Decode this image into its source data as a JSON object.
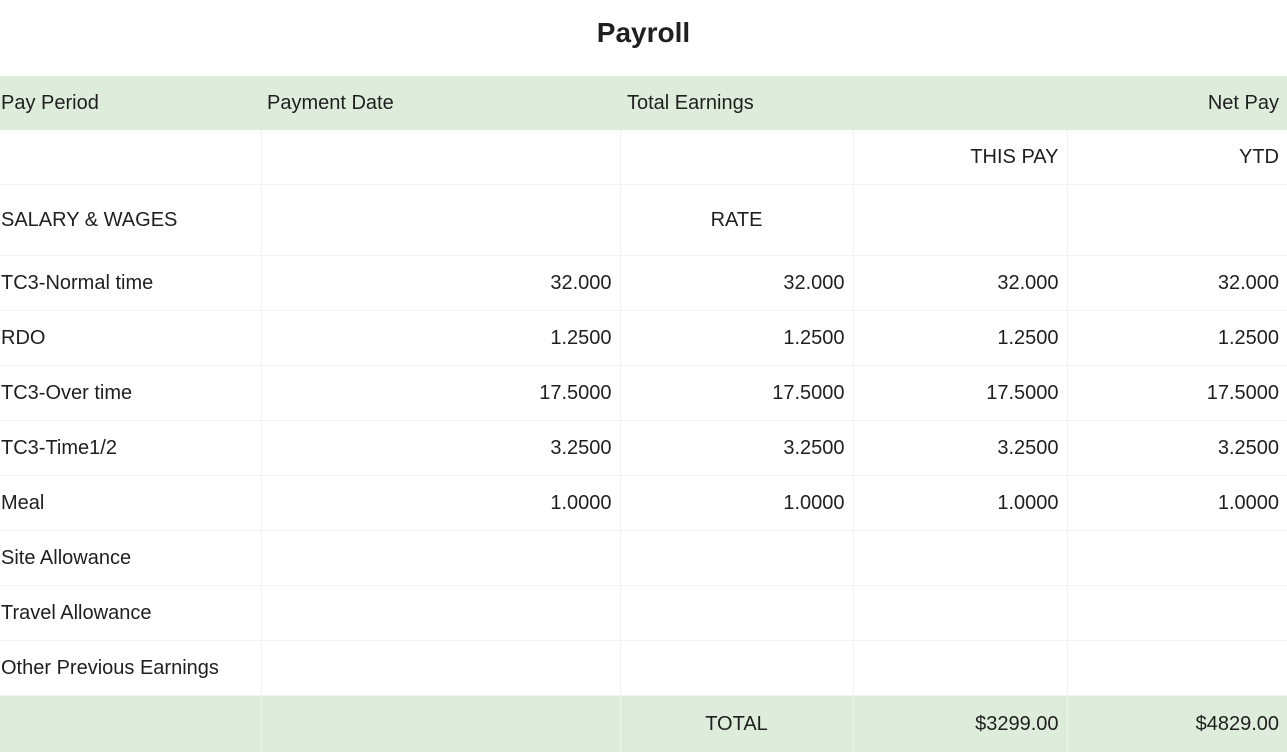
{
  "page": {
    "title": "Payroll"
  },
  "table": {
    "header": {
      "pay_period": "Pay Period",
      "payment_date": "Payment Date",
      "total_earnings": "Total Earnings",
      "net_pay": "Net Pay"
    },
    "subheader": {
      "this_pay": "THIS PAY",
      "ytd": "YTD"
    },
    "section": {
      "label": "SALARY & WAGES",
      "rate": "RATE"
    },
    "rows": [
      {
        "label": "TC3-Normal time",
        "c2": "32.000",
        "c3": "32.000",
        "c4": "32.000",
        "c5": "32.000"
      },
      {
        "label": "RDO",
        "c2": "1.2500",
        "c3": "1.2500",
        "c4": "1.2500",
        "c5": "1.2500"
      },
      {
        "label": "TC3-Over time",
        "c2": "17.5000",
        "c3": "17.5000",
        "c4": "17.5000",
        "c5": "17.5000"
      },
      {
        "label": "TC3-Time1/2",
        "c2": "3.2500",
        "c3": "3.2500",
        "c4": "3.2500",
        "c5": "3.2500"
      },
      {
        "label": "Meal",
        "c2": "1.0000",
        "c3": "1.0000",
        "c4": "1.0000",
        "c5": "1.0000"
      },
      {
        "label": "Site Allowance",
        "c2": "",
        "c3": "",
        "c4": "",
        "c5": ""
      },
      {
        "label": "Travel Allowance",
        "c2": "",
        "c3": "",
        "c4": "",
        "c5": ""
      },
      {
        "label": "Other Previous Earnings",
        "c2": "",
        "c3": "",
        "c4": "",
        "c5": ""
      }
    ],
    "total": {
      "label": "TOTAL",
      "this_pay": "$3299.00",
      "ytd": "$4829.00"
    }
  },
  "colors": {
    "header_bg": "#deeddb",
    "text": "#1f1f1f",
    "grid": "#f2f2f2"
  }
}
